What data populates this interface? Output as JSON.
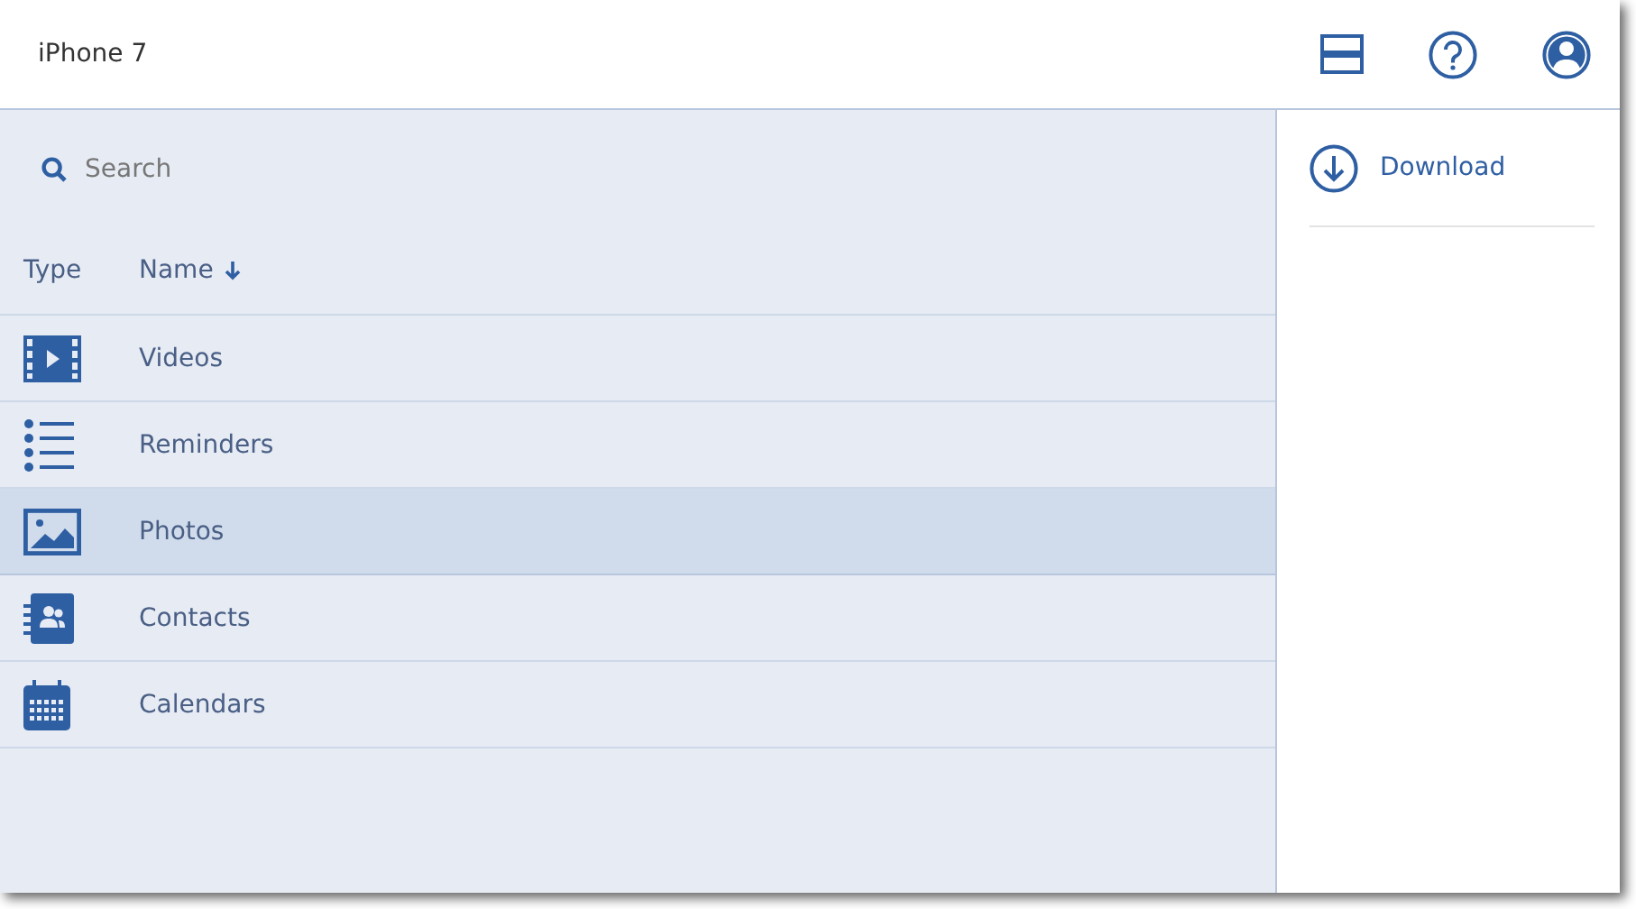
{
  "header": {
    "title": "iPhone 7"
  },
  "search": {
    "placeholder": "Search"
  },
  "table": {
    "columns": [
      {
        "label": "Type",
        "sorted": false
      },
      {
        "label": "Name",
        "sorted": true
      }
    ],
    "rows": [
      {
        "kind": "video",
        "name": "Videos",
        "selected": false
      },
      {
        "kind": "list",
        "name": "Reminders",
        "selected": false
      },
      {
        "kind": "image",
        "name": "Photos",
        "selected": true
      },
      {
        "kind": "contacts",
        "name": "Contacts",
        "selected": false
      },
      {
        "kind": "calendar",
        "name": "Calendars",
        "selected": false
      }
    ]
  },
  "actions": [
    {
      "label": "Download"
    }
  ]
}
